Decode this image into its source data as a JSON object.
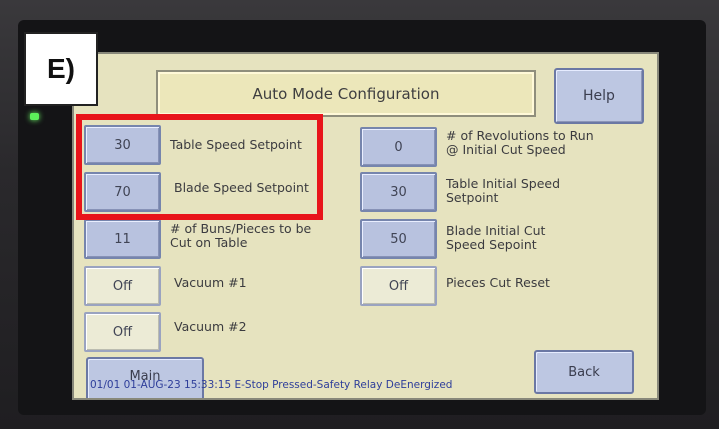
{
  "annotation": {
    "tag": "E)"
  },
  "screen": {
    "title": "Auto Mode Configuration",
    "help_label": "Help",
    "main_label": "Main",
    "back_label": "Back",
    "status_text": "01/01 01-AUG-23 15:33:15 E-Stop Pressed-Safety Relay DeEnergized"
  },
  "left_fields": [
    {
      "value": "30",
      "label": "Table Speed Setpoint"
    },
    {
      "value": "70",
      "label": "Blade Speed Setpoint"
    },
    {
      "value": "11",
      "label_line1": "# of Buns/Pieces to be",
      "label_line2": "Cut on Table"
    },
    {
      "value": "Off",
      "label": "Vacuum #1"
    },
    {
      "value": "Off",
      "label": "Vacuum #2"
    }
  ],
  "right_fields": [
    {
      "value": "0",
      "label_line1": "# of Revolutions to Run",
      "label_line2": "@ Initial Cut Speed"
    },
    {
      "value": "30",
      "label_line1": "Table Initial Speed",
      "label_line2": "Setpoint"
    },
    {
      "value": "50",
      "label_line1": "Blade Initial Cut",
      "label_line2": "Speed Sepoint"
    },
    {
      "value": "Off",
      "label": "Pieces Cut Reset"
    }
  ],
  "colors": {
    "screen_bg": "#e6e3bf",
    "button_blue": "#b8c2df",
    "highlight_red": "#e8141a",
    "status_text": "#2e3e9a"
  }
}
